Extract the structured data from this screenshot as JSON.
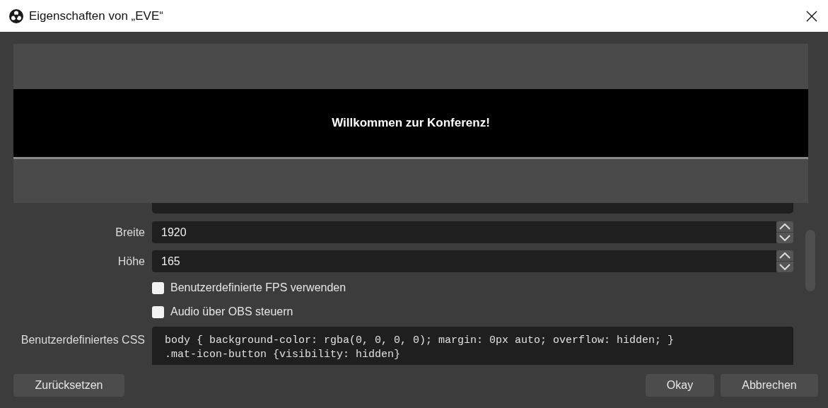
{
  "window": {
    "title": "Eigenschaften von „EVE“"
  },
  "preview": {
    "banner_text": "Willkommen zur Konferenz!"
  },
  "fields": [
    {
      "kind": "spin",
      "label": "Breite",
      "value": "1920"
    },
    {
      "kind": "spin",
      "label": "Höhe",
      "value": "165"
    },
    {
      "kind": "checkbox",
      "label": "Benutzerdefinierte FPS verwenden",
      "checked": false
    },
    {
      "kind": "checkbox",
      "label": "Audio über OBS steuern",
      "checked": false
    },
    {
      "kind": "code",
      "label": "Benutzerdefiniertes CSS",
      "lines": [
        "body { background-color: rgba(0, 0, 0, 0); margin: 0px auto; overflow: hidden; }",
        ".mat-icon-button {visibility: hidden}"
      ]
    }
  ],
  "buttons": {
    "left": [
      "Zurücksetzen"
    ],
    "right": [
      "Okay",
      "Abbrechen"
    ]
  }
}
